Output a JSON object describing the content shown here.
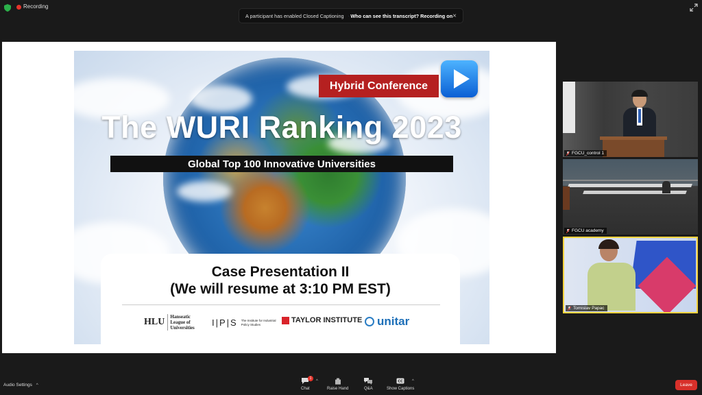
{
  "topbar": {
    "recording_label": "Recording",
    "banner_text": "A participant has enabled Closed Captioning",
    "banner_link": "Who can see this transcript? Recording on",
    "close_glyph": "×"
  },
  "slide": {
    "badge": "Hybrid Conference",
    "title": "The WURI Ranking 2023",
    "subtitle": "Global Top 100 Innovative Universities",
    "case_line1": "Case Presentation II",
    "case_line2": "(We will resume at 3:10 PM EST)",
    "logos": {
      "hlu_short": "HLU",
      "hlu_long": [
        "Hanseatic",
        "League of",
        "Universities"
      ],
      "ips_short": "I|P|S",
      "ips_long": "The Institute for Industrial Policy Studies",
      "taylor": "TAYLOR INSTITUTE",
      "unitar": "unitar"
    }
  },
  "participants": [
    {
      "name": "FGCU_control 1"
    },
    {
      "name": "FGCU academy"
    },
    {
      "name": "Tomislav Papac"
    }
  ],
  "toolbar": {
    "audio_settings": "Audio Settings",
    "chat": "Chat",
    "chat_badge": "1",
    "raise_hand": "Raise Hand",
    "qa": "Q&A",
    "show_captions": "Show Captions",
    "leave": "Leave"
  },
  "colors": {
    "leave": "#d8302a",
    "badge_red": "#b52020",
    "active_speaker": "#f5d33c"
  }
}
